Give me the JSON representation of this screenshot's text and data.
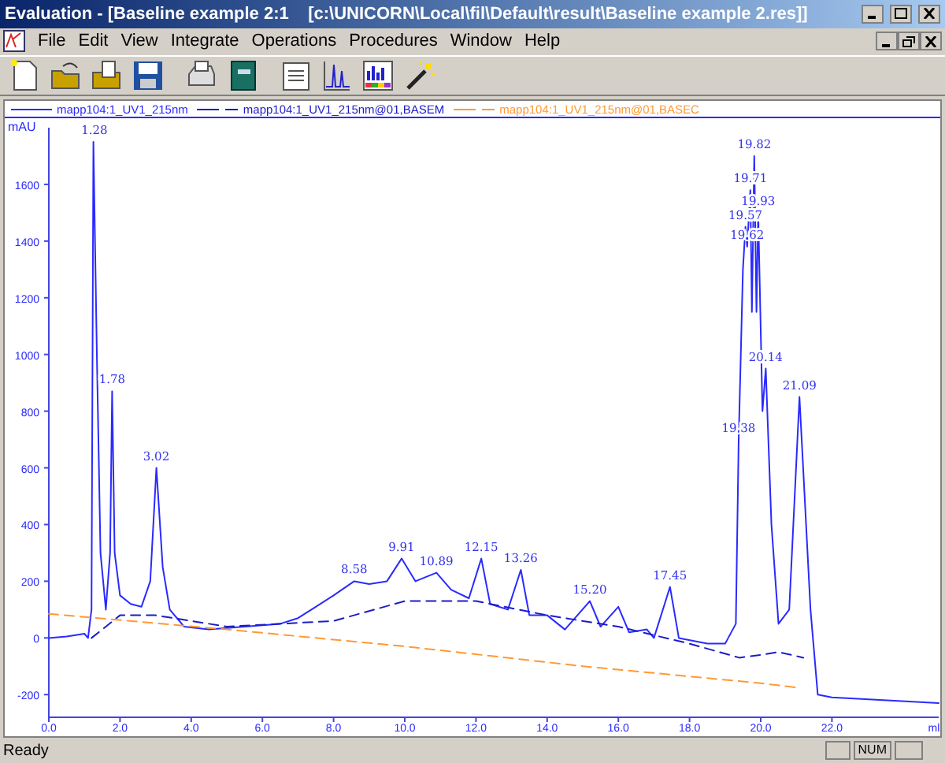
{
  "window": {
    "title": "Evaluation - [Baseline example 2:1    [c:\\UNICORN\\Local\\fil\\Default\\result\\Baseline example 2.res]]"
  },
  "menu": [
    "File",
    "Edit",
    "View",
    "Integrate",
    "Operations",
    "Procedures",
    "Window",
    "Help"
  ],
  "chart": {
    "chart_data": {
      "type": "line",
      "ylabel": "mAU",
      "xlabel": "ml",
      "xlim": [
        0,
        25
      ],
      "ylim": [
        -280,
        1800
      ],
      "xticks": [
        {
          "value": 0,
          "label": "0.0"
        },
        {
          "value": 2,
          "label": "2.0"
        },
        {
          "value": 4,
          "label": "4.0"
        },
        {
          "value": 6,
          "label": "6.0"
        },
        {
          "value": 8,
          "label": "8.0"
        },
        {
          "value": 10,
          "label": "10.0"
        },
        {
          "value": 12,
          "label": "12.0"
        },
        {
          "value": 14,
          "label": "14.0"
        },
        {
          "value": 16,
          "label": "16.0"
        },
        {
          "value": 18,
          "label": "18.0"
        },
        {
          "value": 20,
          "label": "20.0"
        },
        {
          "value": 22,
          "label": "22.0"
        }
      ],
      "yticks": [
        -200,
        0,
        200,
        400,
        600,
        800,
        1000,
        1200,
        1400,
        1600
      ],
      "series": [
        {
          "name": "mapp104:1_UV1_215nm",
          "color": "#2a2aff",
          "x": [
            0,
            0.5,
            1.0,
            1.1,
            1.2,
            1.25,
            1.35,
            1.45,
            1.6,
            1.72,
            1.78,
            1.85,
            2.0,
            2.3,
            2.6,
            2.85,
            3.02,
            3.2,
            3.4,
            3.8,
            4.5,
            5.5,
            6.5,
            7.0,
            7.5,
            8.0,
            8.58,
            9.0,
            9.5,
            9.91,
            10.3,
            10.89,
            11.3,
            11.8,
            12.15,
            12.4,
            12.9,
            13.26,
            13.5,
            14.0,
            14.5,
            15.2,
            15.5,
            16.0,
            16.3,
            16.8,
            17.0,
            17.45,
            17.7,
            18.5,
            19.0,
            19.3,
            19.38,
            19.5,
            19.57,
            19.62,
            19.71,
            19.75,
            19.82,
            19.88,
            19.93,
            20.05,
            20.14,
            20.3,
            20.5,
            20.8,
            21.09,
            21.4,
            21.6,
            22.0,
            25.0
          ],
          "values": [
            0,
            5,
            15,
            0,
            100,
            1750,
            1000,
            300,
            100,
            300,
            870,
            300,
            150,
            120,
            110,
            200,
            600,
            250,
            100,
            40,
            30,
            40,
            50,
            70,
            110,
            150,
            200,
            190,
            200,
            280,
            200,
            230,
            170,
            140,
            280,
            120,
            100,
            240,
            80,
            80,
            30,
            130,
            40,
            110,
            20,
            30,
            0,
            180,
            0,
            -20,
            -20,
            50,
            700,
            1300,
            1450,
            1380,
            1580,
            1150,
            1700,
            1150,
            1500,
            800,
            950,
            400,
            50,
            100,
            850,
            100,
            -200,
            -210,
            -230
          ]
        },
        {
          "name": "mapp104:1_UV1_215nm@01,BASEM",
          "color": "#1c1cc8",
          "line_style": "dashed",
          "x": [
            1.2,
            2,
            3,
            5,
            8,
            10,
            12,
            14,
            16,
            18,
            19.4,
            20,
            20.5,
            21.2
          ],
          "values": [
            0,
            80,
            80,
            40,
            60,
            130,
            130,
            80,
            40,
            -20,
            -70,
            -60,
            -50,
            -70
          ]
        },
        {
          "name": "mapp104:1_UV1_215nm@01,BASEC",
          "color": "#ff9933",
          "line_style": "dashed",
          "x": [
            0,
            5,
            10,
            15,
            20,
            21.0
          ],
          "values": [
            85,
            30,
            -30,
            -100,
            -160,
            -175
          ]
        }
      ],
      "annotations": [
        {
          "x": 1.28,
          "y": 1750,
          "text": "1.28"
        },
        {
          "x": 1.78,
          "y": 870,
          "text": "1.78"
        },
        {
          "x": 3.02,
          "y": 600,
          "text": "3.02"
        },
        {
          "x": 8.58,
          "y": 200,
          "text": "8.58"
        },
        {
          "x": 9.91,
          "y": 280,
          "text": "9.91"
        },
        {
          "x": 10.89,
          "y": 230,
          "text": "10.89"
        },
        {
          "x": 12.15,
          "y": 280,
          "text": "12.15"
        },
        {
          "x": 13.26,
          "y": 240,
          "text": "13.26"
        },
        {
          "x": 15.2,
          "y": 130,
          "text": "15.20"
        },
        {
          "x": 17.45,
          "y": 180,
          "text": "17.45"
        },
        {
          "x": 19.82,
          "y": 1700,
          "text": "19.82"
        },
        {
          "x": 19.71,
          "y": 1580,
          "text": "19.71"
        },
        {
          "x": 19.93,
          "y": 1500,
          "text": "19.93"
        },
        {
          "x": 19.57,
          "y": 1450,
          "text": "19.57"
        },
        {
          "x": 19.62,
          "y": 1380,
          "text": "19.62"
        },
        {
          "x": 20.14,
          "y": 950,
          "text": "20.14"
        },
        {
          "x": 19.38,
          "y": 700,
          "text": "19.38"
        },
        {
          "x": 21.09,
          "y": 850,
          "text": "21.09"
        }
      ]
    }
  },
  "status_bar": {
    "text": "Ready",
    "indicators": [
      "NUM"
    ]
  }
}
